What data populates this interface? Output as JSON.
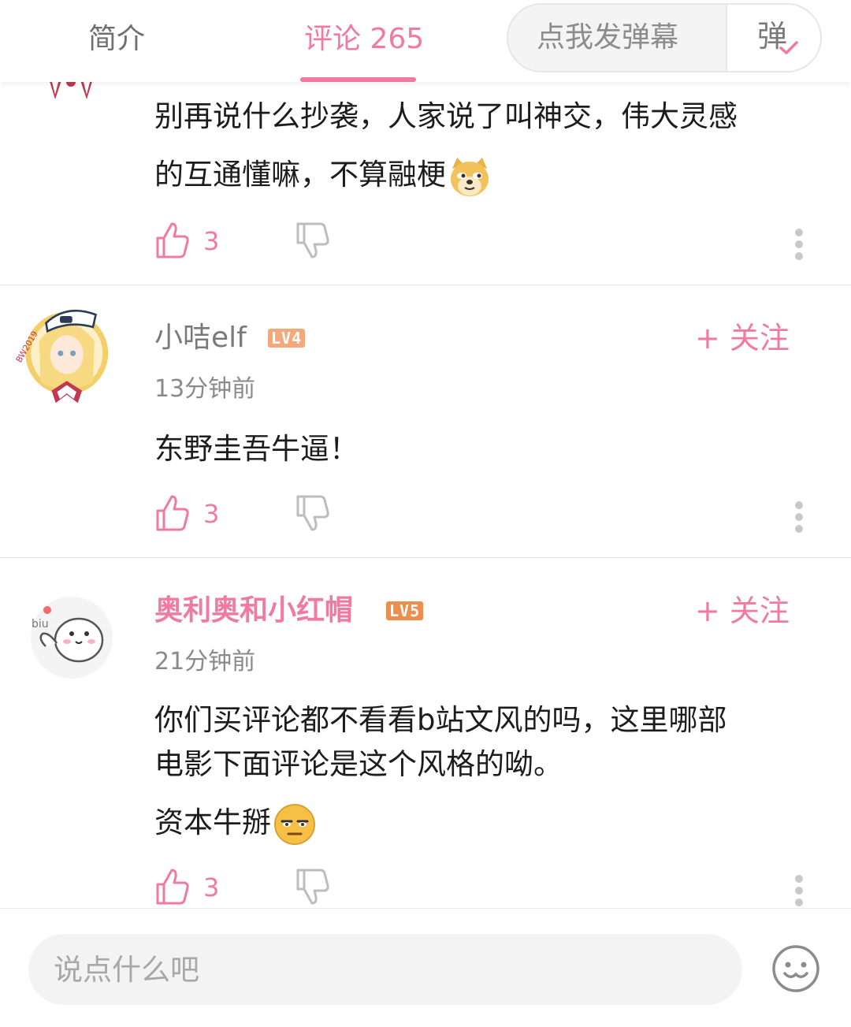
{
  "header": {
    "tab_intro": "简介",
    "tab_comments": "评论 265",
    "danmaku_placeholder": "点我发弹幕",
    "danmaku_toggle": "弹"
  },
  "colors": {
    "accent": "#f07aa0",
    "lv4": "#f5a97a",
    "lv5": "#ef8d4b"
  },
  "comments": [
    {
      "text_line1": "别再说什么抄袭，人家说了叫神交，伟大灵感",
      "text_line2": "的互通懂嘛，不算融梗",
      "emoji": "doge-emoji",
      "likes": "3"
    },
    {
      "username": "小咭elf",
      "level": "LV4",
      "follow": "+ 关注",
      "time": "13分钟前",
      "text_line1": "东野圭吾牛逼！",
      "likes": "3"
    },
    {
      "username": "奥利奥和小红帽",
      "level": "LV5",
      "follow": "+ 关注",
      "time": "21分钟前",
      "text_line1": "你们买评论都不看看b站文风的吗，这里哪部",
      "text_line2": "电影下面评论是这个风格的呦。",
      "text_line3": "资本牛掰",
      "emoji": "tired-face-emoji",
      "likes": "3"
    }
  ],
  "bottom": {
    "input_placeholder": "说点什么吧",
    "emoji_button": "smiley-icon"
  }
}
